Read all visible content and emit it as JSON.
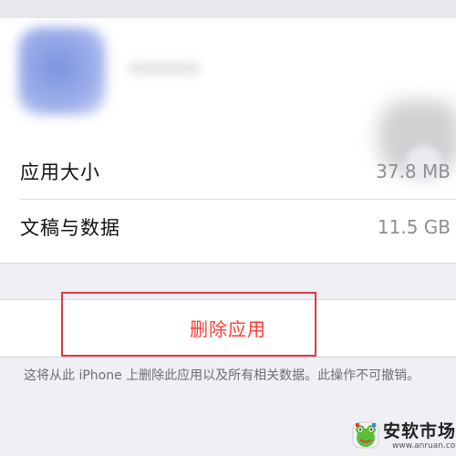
{
  "app_info": {
    "rows": [
      {
        "label": "应用大小",
        "value": "37.8 MB"
      },
      {
        "label": "文稿与数据",
        "value": "11.5 GB"
      }
    ]
  },
  "delete": {
    "label": "删除应用",
    "note": "这将从此 iPhone 上删除此应用以及所有相关数据。此操作不可撤销。"
  },
  "watermark": {
    "text": "安软市场",
    "url": "www.anruan.com",
    "icon": "frog-logo-icon"
  },
  "colors": {
    "background": "#efeff4",
    "destructive": "#ff3b30",
    "highlight_border": "#e0393e",
    "secondary_text": "#8e8e93"
  }
}
